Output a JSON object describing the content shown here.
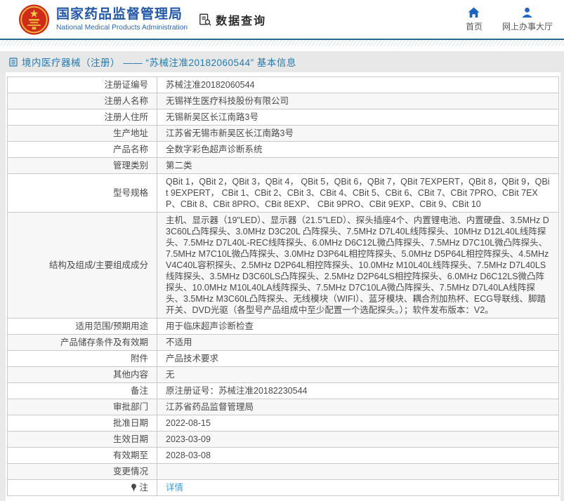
{
  "header": {
    "org_name_zh": "国家药品监督管理局",
    "org_name_en": "National Medical Products Administration",
    "section_label": "数据查询",
    "nav": [
      {
        "label": "首页",
        "icon": "home-icon"
      },
      {
        "label": "网上办事大厅",
        "icon": "user-icon"
      }
    ]
  },
  "page": {
    "title": "境内医疗器械（注册） ——  “苏械注准20182060544”  基本信息"
  },
  "table": {
    "rows": [
      {
        "label": "注册证编号",
        "value": "苏械注准20182060544"
      },
      {
        "label": "注册人名称",
        "value": "无锡祥生医疗科技股份有限公司"
      },
      {
        "label": "注册人住所",
        "value": "无锡新吴区长江南路3号"
      },
      {
        "label": "生产地址",
        "value": "江苏省无锡市新吴区长江南路3号"
      },
      {
        "label": "产品名称",
        "value": "全数字彩色超声诊断系统"
      },
      {
        "label": "管理类别",
        "value": "第二类"
      },
      {
        "label": "型号规格",
        "value": "QBit 1，QBit 2，QBit 3，QBit 4， QBit 5，QBit 6，QBit 7，QBit 7EXPERT，QBit 8，QBit 9，QBit 9EXPERT， CBit 1、CBit 2、CBit 3、CBit 4、CBit 5、CBit 6、CBit 7、CBit 7PRO、CBit 7EXP、CBit 8、CBit 8PRO、CBit 8EXP、 CBit 9PRO、CBit 9EXP、CBit 9、CBit 10"
      },
      {
        "label": "结构及组成/主要组成成分",
        "value": "主机、显示器（19\"LED）、显示器（21.5\"LED）、探头插座4个、内置锂电池、内置硬盘、3.5MHz D3C60L凸阵探头、3.0MHz D3C20L 凸阵探头、7.5MHz D7L40L线阵探头、10MHz D12L40L线阵探头、7.5MHz D7L40L-REC线阵探头、6.0MHz D6C12L微凸阵探头、7.5MHz D7C10L微凸阵探头、7.5MHz M7C10L微凸阵探头、3.0MHz D3P64L相控阵探头、5.0MHz D5P64L相控阵探头、4.5MHz V4C40L容积探头、2.5MHz D2P64L相控阵探头、10.0MHz M10L40L线阵探头、7.5MHz D7L40LS线阵探头、3.5MHz D3C60LS凸阵探头、2.5MHz D2P64LS相控阵探头、6.0MHz D6C12LS微凸阵探头、10.0MHz M10L40LA线阵探头、7.5MHz D7C10LA微凸阵探头、7.5MHz D7L40LA线阵探头、3.5MHz M3C60L凸阵探头、无线模块（WIFI）、蓝牙模块、耦合剂加热杯、ECG导联线、脚踏开关、DVD光驱（各型号产品组成中至少配置一个选配探头。）；软件发布版本：V2。"
      },
      {
        "label": "适用范围/预期用途",
        "value": "用于临床超声诊断检查"
      },
      {
        "label": "产品储存条件及有效期",
        "value": "不适用"
      },
      {
        "label": "附件",
        "value": "产品技术要求"
      },
      {
        "label": "其他内容",
        "value": "无"
      },
      {
        "label": "备注",
        "value": "原注册证号：苏械注准20182230544"
      },
      {
        "label": "审批部门",
        "value": "江苏省药品监督管理局"
      },
      {
        "label": "批准日期",
        "value": "2022-08-15"
      },
      {
        "label": "生效日期",
        "value": "2023-03-09"
      },
      {
        "label": "有效期至",
        "value": "2028-03-08"
      },
      {
        "label": "变更情况",
        "value": ""
      },
      {
        "label": "注",
        "label_icon": "pin-icon",
        "value": "详情",
        "value_is_link": true
      }
    ]
  },
  "colors": {
    "header_text_blue": "#2357a7",
    "header_divider_blue": "#26688f",
    "title_blue": "#2679ae",
    "link_blue": "#3e9cd8",
    "emblem_red": "#d02a1a",
    "nav_icon_blue": "#1c66c0",
    "table_border": "#c9c9c9",
    "alt_row_bg": "#f7f7f7",
    "page_bg": "#e9e9e9"
  }
}
